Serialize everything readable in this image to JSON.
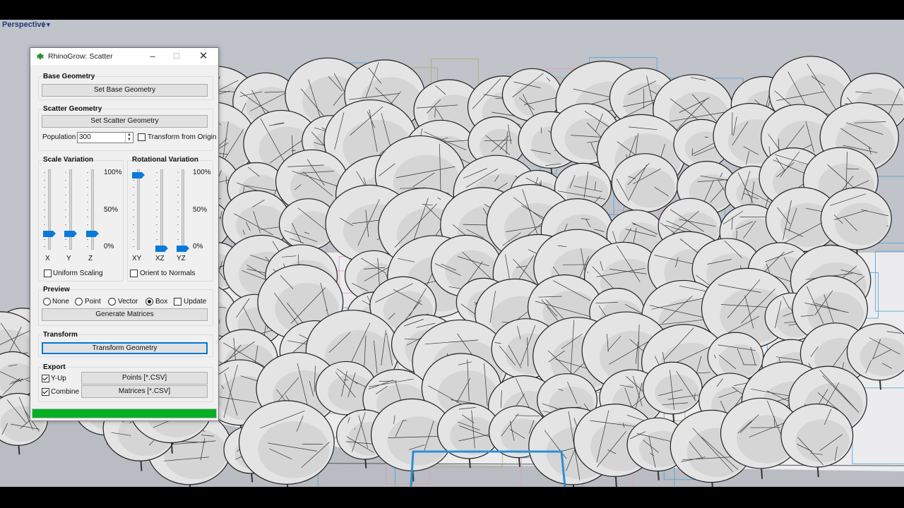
{
  "viewport": {
    "title": "Perspective"
  },
  "dialog": {
    "title": "RhinoGrow: Scatter",
    "base": {
      "heading": "Base Geometry",
      "button": "Set Base Geometry"
    },
    "scatter": {
      "heading": "Scatter Geometry",
      "button": "Set Scatter Geometry",
      "population_label": "Population",
      "population_value": "300",
      "transform_origin_label": "Transform from Origin",
      "transform_origin_checked": false
    },
    "scale": {
      "heading": "Scale Variation",
      "ticks": [
        "100%",
        "50%",
        "0%"
      ],
      "sliders": [
        {
          "label": "X",
          "value": 0.2
        },
        {
          "label": "Y",
          "value": 0.2
        },
        {
          "label": "Z",
          "value": 0.2
        }
      ],
      "uniform_label": "Uniform Scaling",
      "uniform_checked": false
    },
    "rotation": {
      "heading": "Rotational Variation",
      "ticks": [
        "100%",
        "50%",
        "0%"
      ],
      "sliders": [
        {
          "label": "XY",
          "value": 1.0
        },
        {
          "label": "XZ",
          "value": 0.0
        },
        {
          "label": "YZ",
          "value": 0.0
        }
      ],
      "orient_label": "Orient to Normals",
      "orient_checked": false
    },
    "preview": {
      "heading": "Preview",
      "options": [
        "None",
        "Point",
        "Vector",
        "Box"
      ],
      "selected": "Box",
      "update_label": "Update",
      "update_checked": false,
      "button": "Generate Matrices"
    },
    "transform": {
      "heading": "Transform",
      "button": "Transform Geometry"
    },
    "export": {
      "heading": "Export",
      "yup_label": "Y-Up",
      "yup_checked": true,
      "combine_label": "Combine",
      "combine_checked": true,
      "points_button": "Points [*.CSV]",
      "matrices_button": "Matrices [*.CSV]"
    },
    "progress": 1.0
  },
  "colors": {
    "accent": "#0078d7",
    "slider_thumb": "#0a7ad8",
    "progress": "#06b025",
    "viewport_bg": "#c0c3c9"
  }
}
